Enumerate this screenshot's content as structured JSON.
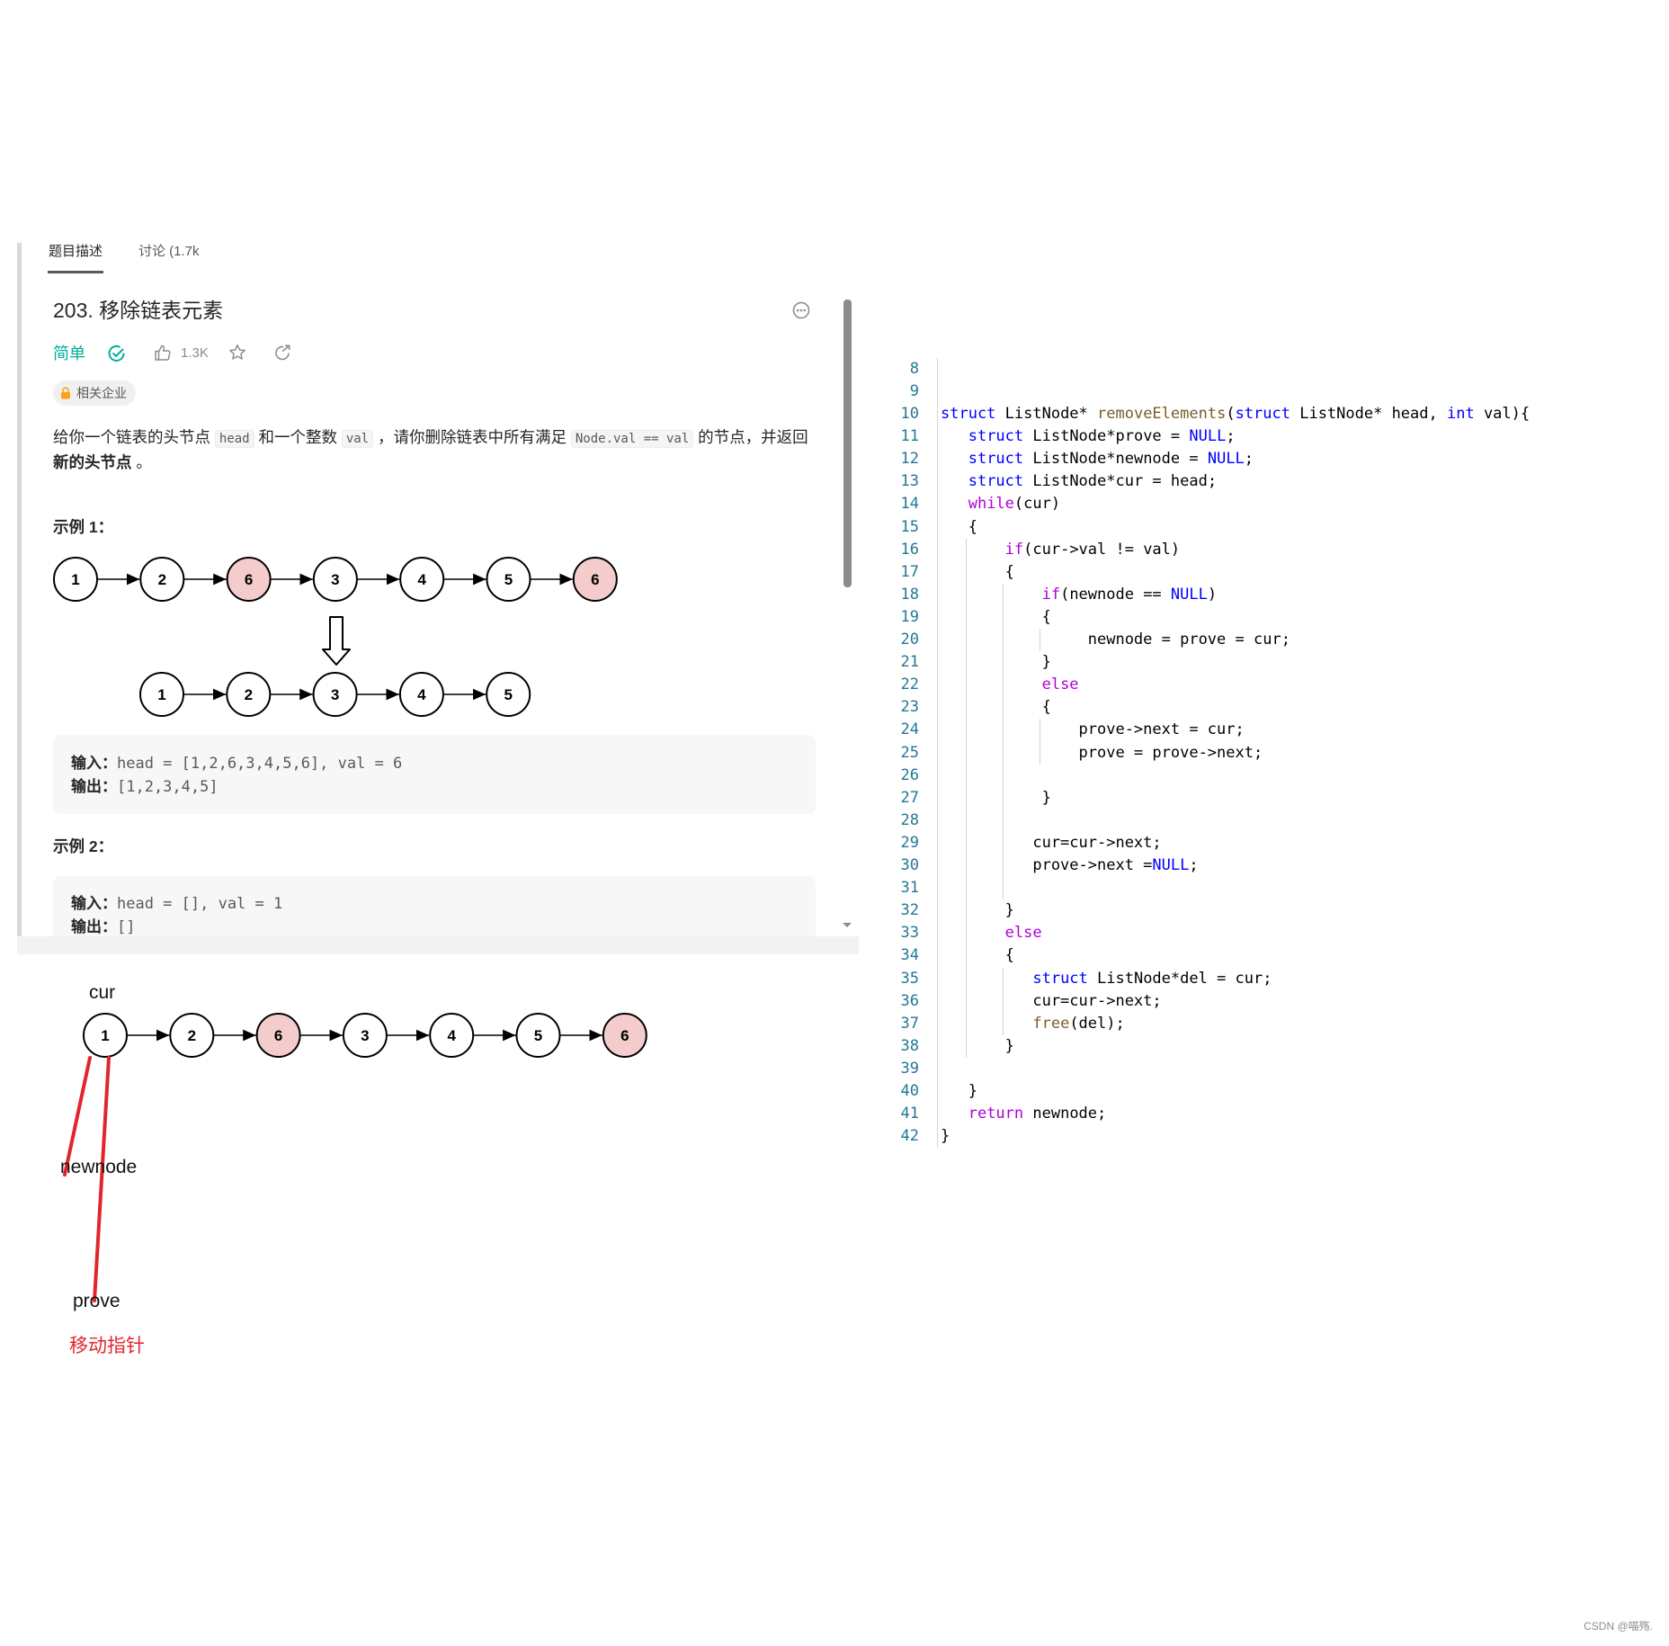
{
  "tabs": [
    {
      "label": "题目描述",
      "active": true
    },
    {
      "label": "讨论 (1.7k",
      "active": false
    }
  ],
  "problem": {
    "title": "203. 移除链表元素",
    "difficulty": "简单",
    "likes": "1.3K",
    "company_tag": "相关企业",
    "desc_part1": "给你一个链表的头节点 ",
    "desc_code1": "head",
    "desc_part2": " 和一个整数 ",
    "desc_code2": "val",
    "desc_part3": " ，请你删除链表中所有满足 ",
    "desc_code3": "Node.val == val",
    "desc_part4": " 的节点，并返回 ",
    "desc_bold": "新的头节点",
    "desc_end": " 。"
  },
  "examples": [
    {
      "heading": "示例 1：",
      "input_label": "输入：",
      "input_value": "head = [1,2,6,3,4,5,6], val = 6",
      "output_label": "输出：",
      "output_value": "[1,2,3,4,5]",
      "diagram_before": [
        "1",
        "2",
        "6",
        "3",
        "4",
        "5",
        "6"
      ],
      "diagram_after": [
        "1",
        "2",
        "3",
        "4",
        "5"
      ],
      "highlighted_value": "6"
    },
    {
      "heading": "示例 2：",
      "input_label": "输入：",
      "input_value": "head = [], val = 1",
      "output_label": "输出：",
      "output_value": "[]"
    }
  ],
  "annotation": {
    "cur_label": "cur",
    "newnode_label": "newnode",
    "prove_label": "prove",
    "note": "移动指针",
    "nodes": [
      "1",
      "2",
      "6",
      "3",
      "4",
      "5",
      "6"
    ],
    "pointer_color": "#e1262b"
  },
  "colors": {
    "node_highlight": "#f4cccc",
    "accent_green": "#00af9b",
    "keyword": "#0000ff",
    "control": "#af00db",
    "function": "#795e26",
    "line_number": "#237893"
  },
  "code": {
    "first_line_number": 8,
    "lines": [
      "",
      "",
      "struct ListNode* removeElements(struct ListNode* head, int val){",
      "   struct ListNode*prove = NULL;",
      "   struct ListNode*newnode = NULL;",
      "   struct ListNode*cur = head;",
      "   while(cur)",
      "   {",
      "       if(cur->val != val)",
      "       {",
      "           if(newnode == NULL)",
      "           {",
      "                newnode = prove = cur;",
      "           }",
      "           else",
      "           {",
      "               prove->next = cur;",
      "               prove = prove->next;",
      "",
      "           }",
      "",
      "          cur=cur->next;",
      "          prove->next =NULL;",
      "",
      "       }",
      "       else",
      "       {",
      "          struct ListNode*del = cur;",
      "          cur=cur->next;",
      "          free(del);",
      "       }",
      "",
      "   }",
      "   return newnode;",
      "}"
    ]
  },
  "watermark": "CSDN @喵殇."
}
